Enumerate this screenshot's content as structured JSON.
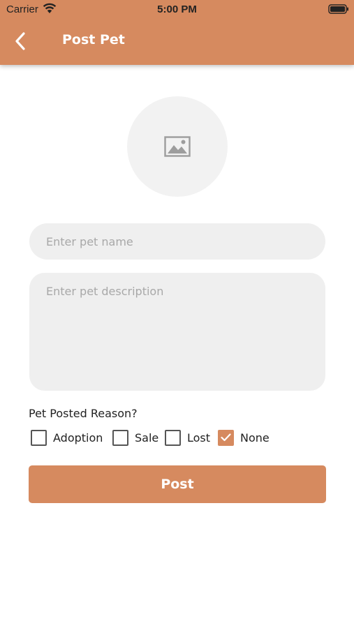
{
  "status_bar": {
    "carrier": "Carrier",
    "time": "5:00 PM"
  },
  "header": {
    "title": "Post Pet",
    "background_color": "#d68a5f"
  },
  "image_picker": {
    "icon": "image-placeholder-icon"
  },
  "form": {
    "name_placeholder": "Enter pet name",
    "name_value": "",
    "description_placeholder": "Enter pet description",
    "description_value": "",
    "reason_label": "Pet Posted Reason?",
    "options": [
      {
        "label": "Adoption",
        "checked": false
      },
      {
        "label": "Sale",
        "checked": false
      },
      {
        "label": "Lost",
        "checked": false
      },
      {
        "label": "None",
        "checked": true
      }
    ],
    "submit_label": "Post"
  },
  "colors": {
    "accent": "#d68a5f",
    "field_background": "#efefef",
    "placeholder_text": "#a8a8a8"
  }
}
